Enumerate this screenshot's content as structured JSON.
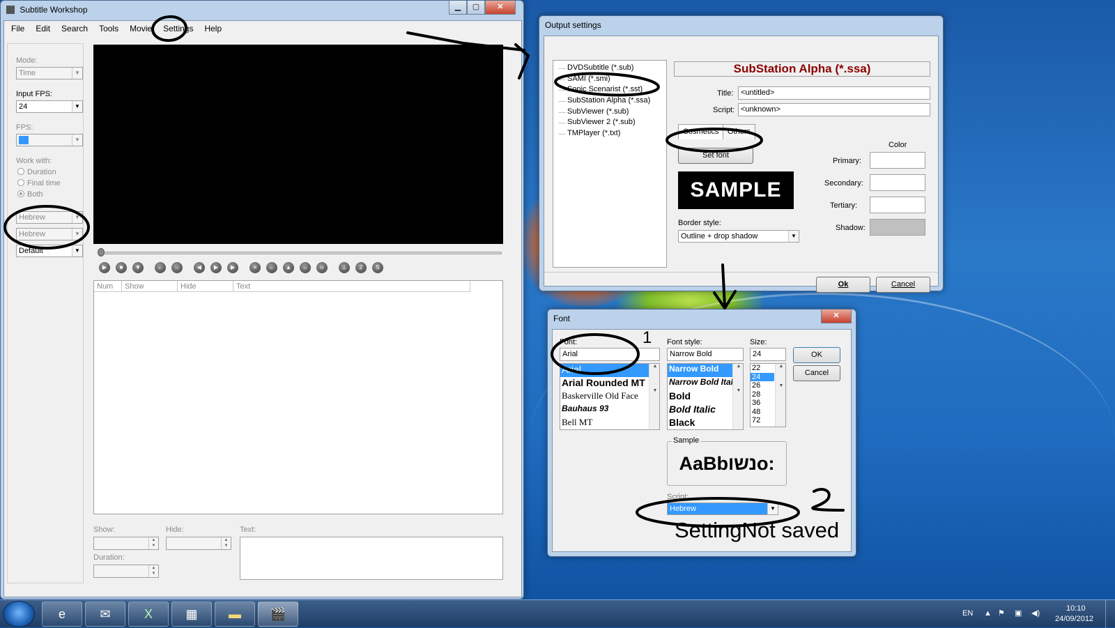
{
  "main_window": {
    "title": "Subtitle Workshop",
    "menu": [
      "File",
      "Edit",
      "Search",
      "Tools",
      "Movie",
      "Settings",
      "Help"
    ],
    "side": {
      "mode_label": "Mode:",
      "mode_value": "Time",
      "input_fps_label": "Input FPS:",
      "input_fps_value": "24",
      "fps_label": "FPS:",
      "work_with_label": "Work with:",
      "work_with_options": [
        "Duration",
        "Final time",
        "Both"
      ],
      "lang1": "Hebrew",
      "lang2": "Hebrew",
      "style": "Default"
    },
    "grid_columns": [
      "Num",
      "Show",
      "Hide",
      "Text"
    ],
    "fields": {
      "show": "Show:",
      "hide": "Hide:",
      "text": "Text:",
      "duration": "Duration:"
    }
  },
  "output_settings": {
    "title": "Output settings",
    "formats": [
      "DVDSubtitle (*.sub)",
      "SAMI (*.smi)",
      "Sonic Scenarist (*.sst)",
      "SubStation Alpha (*.ssa)",
      "SubViewer (*.sub)",
      "SubViewer 2 (*.sub)",
      "TMPlayer (*.txt)"
    ],
    "selected_format": "SubStation Alpha (*.ssa)",
    "title_label": "Title:",
    "title_value": "<untitled>",
    "script_label": "Script:",
    "script_value": "<unknown>",
    "tabs": [
      "Cosmetics",
      "Others"
    ],
    "set_font": "Set font",
    "sample": "SAMPLE",
    "color_header": "Color",
    "color_labels": [
      "Primary:",
      "Secondary:",
      "Tertiary:",
      "Shadow:"
    ],
    "border_style_label": "Border style:",
    "border_style_value": "Outline + drop shadow",
    "ok": "Ok",
    "cancel": "Cancel"
  },
  "font_dialog": {
    "title": "Font",
    "font_label": "Font:",
    "font_value": "Arial",
    "fonts": [
      "Arial",
      "Arial Rounded MT",
      "Baskerville Old Face",
      "Bauhaus 93",
      "Bell MT"
    ],
    "style_label": "Font style:",
    "style_value": "Narrow Bold",
    "styles": [
      "Narrow Bold",
      "Narrow Bold Italic",
      "Bold",
      "Bold Italic",
      "Black"
    ],
    "size_label": "Size:",
    "size_value": "24",
    "sizes": [
      "22",
      "24",
      "26",
      "28",
      "36",
      "48",
      "72"
    ],
    "ok": "OK",
    "cancel": "Cancel",
    "sample_label": "Sample",
    "sample_text": "AaBbנשוo:",
    "script_label": "Script:",
    "script_value": "Hebrew",
    "note": "SettingNot saved"
  },
  "annotations": {
    "num1": "1",
    "num2": "2"
  },
  "taskbar": {
    "lang": "EN",
    "time": "10:10",
    "date": "24/09/2012"
  },
  "colors": {
    "accent": "#3399ff",
    "format_title": "#8b0000",
    "shadow_swatch": "#c0c0c0"
  }
}
